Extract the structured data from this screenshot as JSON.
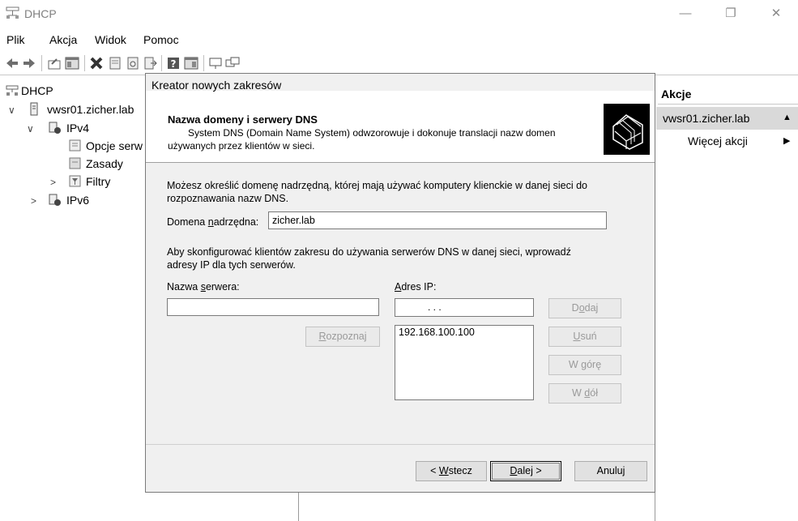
{
  "window": {
    "title": "DHCP",
    "controls": [
      "—",
      "❐",
      "✕"
    ]
  },
  "menu": [
    "Plik",
    "Akcja",
    "Widok",
    "Pomoc"
  ],
  "toolbar": [
    "back-icon",
    "forward-icon",
    "up-icon",
    "console-tree-icon",
    "delete-icon",
    "properties-icon",
    "refresh-icon",
    "export-icon",
    "help-icon",
    "action-pane-icon",
    "server-icon",
    "scope-icon"
  ],
  "tree": {
    "root": "DHCP",
    "server": "vwsr01.zicher.lab",
    "ipv4": "IPv4",
    "scope_options": "Opcje serw",
    "policies": "Zasady",
    "filters": "Filtry",
    "ipv6": "IPv6"
  },
  "actions": {
    "header": "Akcje",
    "selected": "vwsr01.zicher.lab",
    "more": "Więcej akcji"
  },
  "dialog": {
    "title": "Kreator nowych zakresów",
    "heading": "Nazwa domeny i serwery DNS",
    "subheading_line1": "System DNS (Domain Name System) odwzorowuje i dokonuje translacji nazw domen",
    "subheading_line2": "używanych przez klientów w sieci.",
    "intro_line1": "Możesz określić domenę nadrzędną, której mają używać komputery klienckie w danej sieci do",
    "intro_line2": "rozpoznawania nazw DNS.",
    "parent_domain_label_pre": "Domena ",
    "parent_domain_label_accel": "n",
    "parent_domain_label_post": "adrzędna:",
    "parent_domain_value": "zicher.lab",
    "dns_intro_line1": "Aby skonfigurować klientów zakresu do używania serwerów DNS w danej sieci, wprowadź",
    "dns_intro_line2": "adresy IP dla tych serwerów.",
    "server_name_label_pre": "Nazwa ",
    "server_name_label_accel": "s",
    "server_name_label_post": "erwera:",
    "server_name_value": "",
    "ip_label_accel": "A",
    "ip_label_post": "dres IP:",
    "ip_input_value": ".        .        .",
    "resolve_accel": "R",
    "resolve_post": "ozpoznaj",
    "add_pre": "D",
    "add_accel": "o",
    "add_post": "daj",
    "remove_accel": "U",
    "remove_post": "suń",
    "up_pre": "W ",
    "up_accel": "g",
    "up_post": "órę",
    "down_pre": "W ",
    "down_accel": "d",
    "down_post": "ół",
    "ip_list": [
      "192.168.100.100"
    ],
    "back_pre": "< ",
    "back_accel": "W",
    "back_post": "stecz",
    "next_accel": "D",
    "next_post": "alej >",
    "cancel": "Anuluj"
  }
}
